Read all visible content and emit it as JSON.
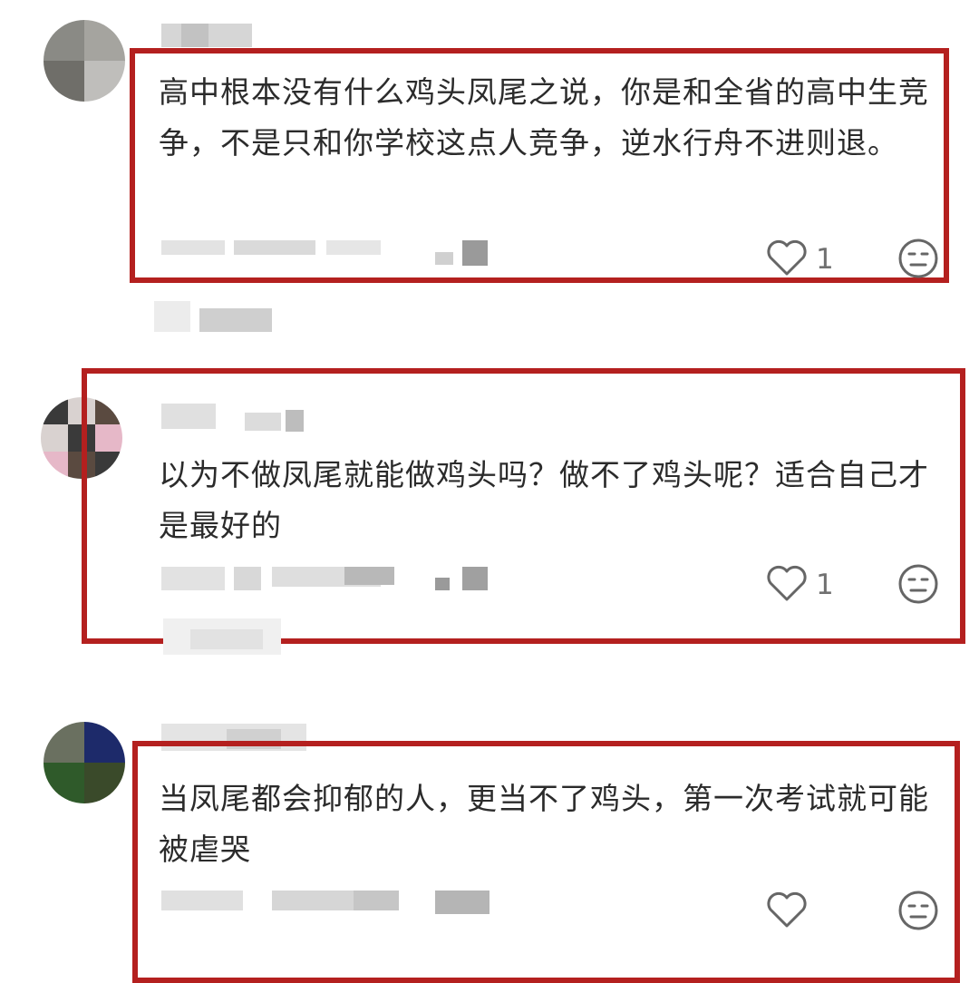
{
  "comments": [
    {
      "text": "高中根本没有什么鸡头凤尾之说，你是和全省的高中生竞争，不是只和你学校这点人竞争，逆水行舟不进则退。",
      "likes": "1",
      "avatar_colors": [
        "#8a8a85",
        "#a5a49f",
        "#6f6e69",
        "#bfbebb"
      ],
      "border_color": "#b4201f"
    },
    {
      "text": "以为不做凤尾就能做鸡头吗？做不了鸡头呢？适合自己才是最好的",
      "likes": "1",
      "avatar_colors": [
        "#3a3a3a",
        "#e6b8c8",
        "#d9d2d0",
        "#5a4a40"
      ],
      "border_color": "#b4201f"
    },
    {
      "text": "当凤尾都会抑郁的人，更当不了鸡头，第一次考试就可能被虐哭",
      "likes": "",
      "avatar_colors": [
        "#2f5a2a",
        "#1d2a6a",
        "#6a7060",
        "#3a4a2a"
      ],
      "border_color": "#b4201f"
    }
  ],
  "icons": {
    "like": "heart-outline-icon",
    "dislike": "neutral-face-icon"
  }
}
